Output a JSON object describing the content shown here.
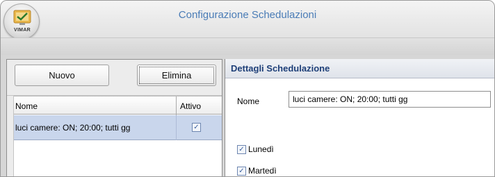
{
  "window": {
    "title": "Configurazione Schedulazioni",
    "logo_text": "VIMAR"
  },
  "toolbar": {
    "new_label": "Nuovo",
    "delete_label": "Elimina"
  },
  "grid": {
    "columns": [
      "Nome",
      "Attivo"
    ],
    "rows": [
      {
        "name": "luci camere: ON; 20:00; tutti gg",
        "active": true
      }
    ]
  },
  "details": {
    "title": "Dettagli Schedulazione",
    "name_label": "Nome",
    "name_value": "luci camere: ON; 20:00; tutti gg",
    "days": [
      {
        "label": "Lunedì",
        "checked": true
      },
      {
        "label": "Martedì",
        "checked": true
      }
    ]
  },
  "colors": {
    "title_text": "#4a7cb6",
    "selected_row": "#c9d6ec",
    "header_text": "#1e3f78"
  },
  "icons": {
    "logo": "vimar-logo-icon",
    "check": "checkmark-icon"
  }
}
